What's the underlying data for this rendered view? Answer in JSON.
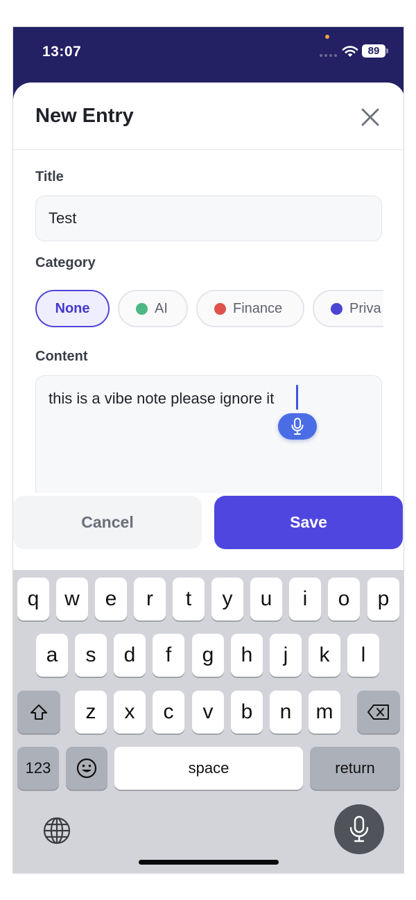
{
  "status_bar": {
    "time": "13:07",
    "battery": "89"
  },
  "sheet": {
    "title": "New Entry",
    "title_label": "Title",
    "title_value": "Test",
    "category_label": "Category",
    "categories": [
      {
        "label": "None",
        "selected": true
      },
      {
        "label": "AI",
        "color": "#4cb782"
      },
      {
        "label": "Finance",
        "color": "#e0524b"
      },
      {
        "label": "Priva",
        "color": "#4b45d6"
      }
    ],
    "content_label": "Content",
    "content_value": "this is a vibe note please ignore it",
    "cancel_label": "Cancel",
    "save_label": "Save"
  },
  "keyboard": {
    "row1": [
      "q",
      "w",
      "e",
      "r",
      "t",
      "y",
      "u",
      "i",
      "o",
      "p"
    ],
    "row2": [
      "a",
      "s",
      "d",
      "f",
      "g",
      "h",
      "j",
      "k",
      "l"
    ],
    "row3": [
      "z",
      "x",
      "c",
      "v",
      "b",
      "n",
      "m"
    ],
    "numbers_label": "123",
    "space_label": "space",
    "return_label": "return"
  },
  "colors": {
    "accent": "#4f46e0",
    "header_bg": "#232063"
  },
  "icons": {
    "close": "close-icon",
    "shift": "shift-icon",
    "backspace": "backspace-icon",
    "emoji": "emoji-icon",
    "globe": "globe-icon",
    "mic": "microphone-icon"
  }
}
